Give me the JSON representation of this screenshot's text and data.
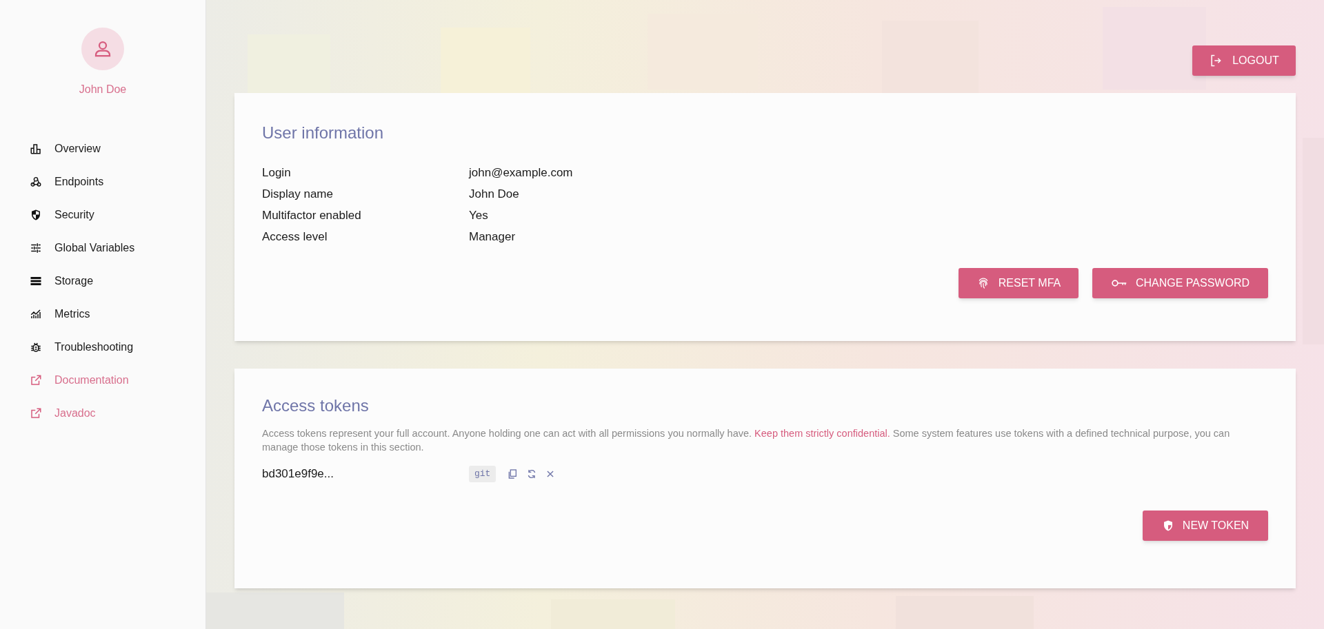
{
  "sidebar": {
    "user_name": "John Doe",
    "items": [
      {
        "label": "Overview",
        "kind": "internal"
      },
      {
        "label": "Endpoints",
        "kind": "internal"
      },
      {
        "label": "Security",
        "kind": "internal"
      },
      {
        "label": "Global Variables",
        "kind": "internal"
      },
      {
        "label": "Storage",
        "kind": "internal"
      },
      {
        "label": "Metrics",
        "kind": "internal"
      },
      {
        "label": "Troubleshooting",
        "kind": "internal"
      },
      {
        "label": "Documentation",
        "kind": "external"
      },
      {
        "label": "Javadoc",
        "kind": "external"
      }
    ]
  },
  "logout_button": "LOGOUT",
  "user_information": {
    "title": "User information",
    "fields": [
      {
        "label": "Login",
        "value": "john@example.com"
      },
      {
        "label": "Display name",
        "value": "John Doe"
      },
      {
        "label": "Multifactor enabled",
        "value": "Yes"
      },
      {
        "label": "Access level",
        "value": "Manager"
      }
    ],
    "buttons": [
      "RESET MFA",
      "CHANGE PASSWORD"
    ]
  },
  "access_tokens": {
    "title": "Access tokens",
    "description": "Access tokens represent your full account. Anyone holding one can act with all permissions you normally have. ",
    "warning": "Keep them strictly confidential.",
    "description_end": " Some system features use tokens with a defined technical purpose, you can manage those tokens in this section.",
    "tokens": [
      {
        "token": "bd301e9f9e...",
        "tag": "git"
      }
    ],
    "new_button": "NEW TOKEN"
  }
}
